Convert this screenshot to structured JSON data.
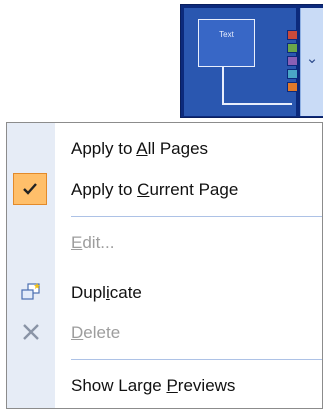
{
  "thumbnail": {
    "text_box_label": "Text",
    "swatches": [
      "#c94a3a",
      "#6aa64a",
      "#8a5fb5",
      "#4aa7c6",
      "#e07a2a"
    ]
  },
  "menu": {
    "items": [
      {
        "pre": "Apply to ",
        "key": "A",
        "post": "ll Pages"
      },
      {
        "pre": "Apply to ",
        "key": "C",
        "post": "urrent Page"
      },
      {
        "pre": "",
        "key": "E",
        "post": "dit..."
      },
      {
        "pre": "Dupl",
        "key": "i",
        "post": "cate"
      },
      {
        "pre": "",
        "key": "D",
        "post": "elete"
      },
      {
        "pre": "Show Large ",
        "key": "P",
        "post": "reviews"
      }
    ]
  }
}
